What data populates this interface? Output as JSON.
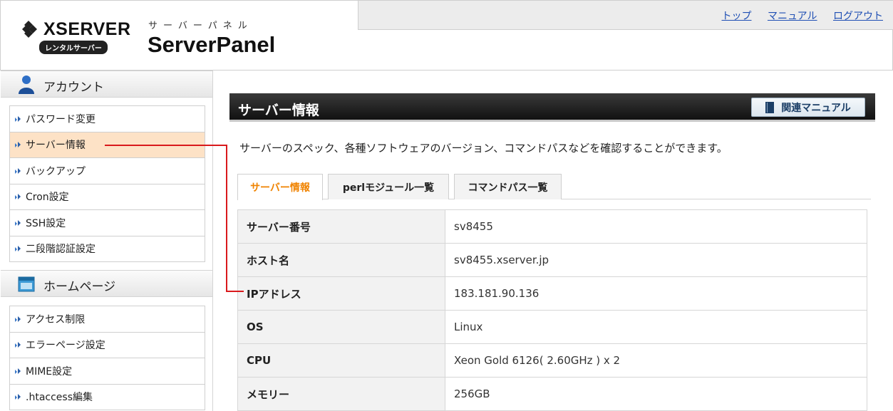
{
  "header": {
    "brand": "XSERVER",
    "brand_sub": "レンタルサーバー",
    "panel_kana": "サーバーパネル",
    "panel_name": "ServerPanel",
    "links": [
      "トップ",
      "マニュアル",
      "ログアウト"
    ]
  },
  "sidebar": {
    "sections": [
      {
        "title": "アカウント",
        "icon": "user-icon",
        "items": [
          "パスワード変更",
          "サーバー情報",
          "バックアップ",
          "Cron設定",
          "SSH設定",
          "二段階認証設定"
        ],
        "active": "サーバー情報"
      },
      {
        "title": "ホームページ",
        "icon": "homepage-icon",
        "items": [
          "アクセス制限",
          "エラーページ設定",
          "MIME設定",
          ".htaccess編集"
        ]
      }
    ]
  },
  "main": {
    "title": "サーバー情報",
    "manual_button": "関連マニュアル",
    "description": "サーバーのスペック、各種ソフトウェアのバージョン、コマンドパスなどを確認することができます。",
    "tabs": [
      "サーバー情報",
      "perlモジュール一覧",
      "コマンドパス一覧"
    ],
    "active_tab": "サーバー情報",
    "rows": [
      {
        "key": "サーバー番号",
        "value": "sv8455"
      },
      {
        "key": "ホスト名",
        "value": "sv8455.xserver.jp"
      },
      {
        "key": "IPアドレス",
        "value": "183.181.90.136"
      },
      {
        "key": "OS",
        "value": "Linux"
      },
      {
        "key": "CPU",
        "value": "Xeon Gold 6126( 2.60GHz ) x 2"
      },
      {
        "key": "メモリー",
        "value": "256GB"
      }
    ]
  },
  "colors": {
    "accent_orange": "#f08300",
    "active_bg": "#fde2c6",
    "callout_red": "#d9191c",
    "link_blue": "#1f4fb4"
  }
}
